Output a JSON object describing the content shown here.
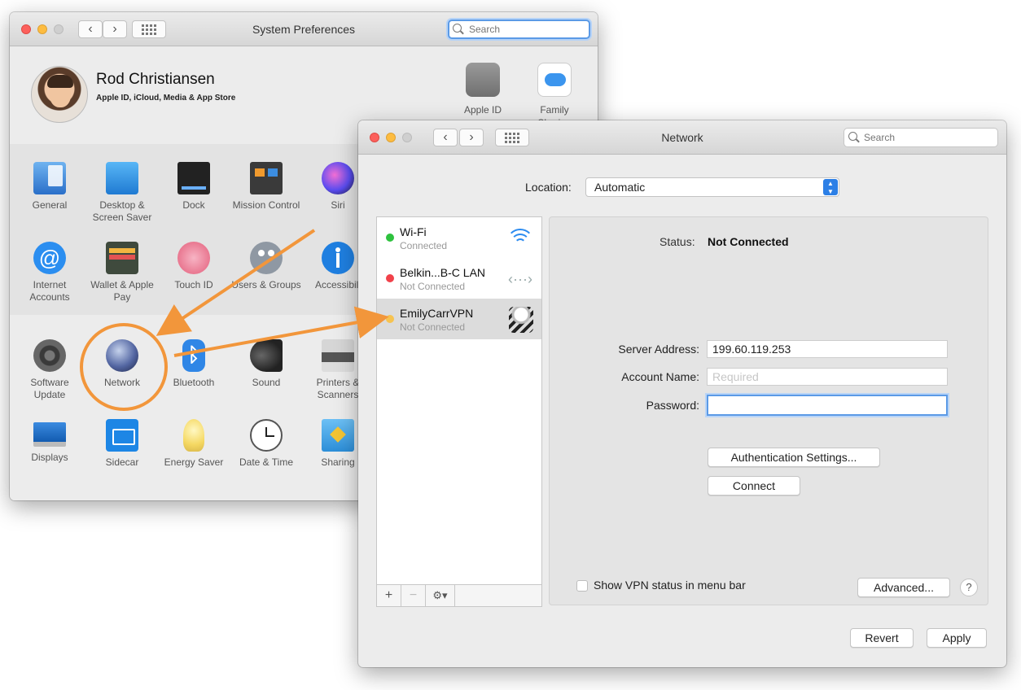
{
  "sysprefs": {
    "title": "System Preferences",
    "search_placeholder": "Search",
    "user": {
      "name": "Rod Christiansen",
      "subtitle": "Apple ID, iCloud, Media & App Store"
    },
    "top_icons": [
      {
        "label": "Apple ID"
      },
      {
        "label": "Family Sharing"
      }
    ],
    "prefs": [
      {
        "label": "General",
        "icon": "general-icon"
      },
      {
        "label": "Desktop & Screen Saver",
        "icon": "desktop-icon"
      },
      {
        "label": "Dock",
        "icon": "dock-icon"
      },
      {
        "label": "Mission Control",
        "icon": "mission-control-icon"
      },
      {
        "label": "Siri",
        "icon": "siri-icon"
      },
      {
        "label": "Internet Accounts",
        "icon": "at-icon"
      },
      {
        "label": "Wallet & Apple Pay",
        "icon": "wallet-icon"
      },
      {
        "label": "Touch ID",
        "icon": "fingerprint-icon"
      },
      {
        "label": "Users & Groups",
        "icon": "users-icon"
      },
      {
        "label": "Accessibili",
        "icon": "accessibility-icon"
      },
      {
        "label": "Software Update",
        "icon": "gear-icon"
      },
      {
        "label": "Network",
        "icon": "globe-icon"
      },
      {
        "label": "Bluetooth",
        "icon": "bluetooth-icon"
      },
      {
        "label": "Sound",
        "icon": "speaker-icon"
      },
      {
        "label": "Printers & Scanners",
        "icon": "printer-icon"
      },
      {
        "label": "Displays",
        "icon": "monitor-icon"
      },
      {
        "label": "Sidecar",
        "icon": "sidecar-icon"
      },
      {
        "label": "Energy Saver",
        "icon": "lightbulb-icon"
      },
      {
        "label": "Date & Time",
        "icon": "clock-icon"
      },
      {
        "label": "Sharing",
        "icon": "folder-icon"
      }
    ]
  },
  "network": {
    "title": "Network",
    "search_placeholder": "Search",
    "location_label": "Location:",
    "location_value": "Automatic",
    "services": [
      {
        "name": "Wi-Fi",
        "status": "Connected",
        "dot_color": "#2ec23e"
      },
      {
        "name": "Belkin...B-C LAN",
        "status": "Not Connected",
        "dot_color": "#f1414a"
      },
      {
        "name": "EmilyCarrVPN",
        "status": "Not Connected",
        "dot_color": "#f6c350"
      }
    ],
    "status_label": "Status:",
    "status_value": "Not Connected",
    "server_address_label": "Server Address:",
    "server_address_value": "199.60.119.253",
    "account_name_label": "Account Name:",
    "account_name_placeholder": "Required",
    "password_label": "Password:",
    "password_value": "",
    "auth_settings_label": "Authentication Settings...",
    "connect_label": "Connect",
    "show_vpn_label": "Show VPN status in menu bar",
    "advanced_label": "Advanced...",
    "help_label": "?",
    "revert_label": "Revert",
    "apply_label": "Apply",
    "add_label": "+",
    "remove_label": "−"
  },
  "accent_colors": {
    "annotation_orange": "#f2963b",
    "focus_blue": "#5b9ae6"
  }
}
